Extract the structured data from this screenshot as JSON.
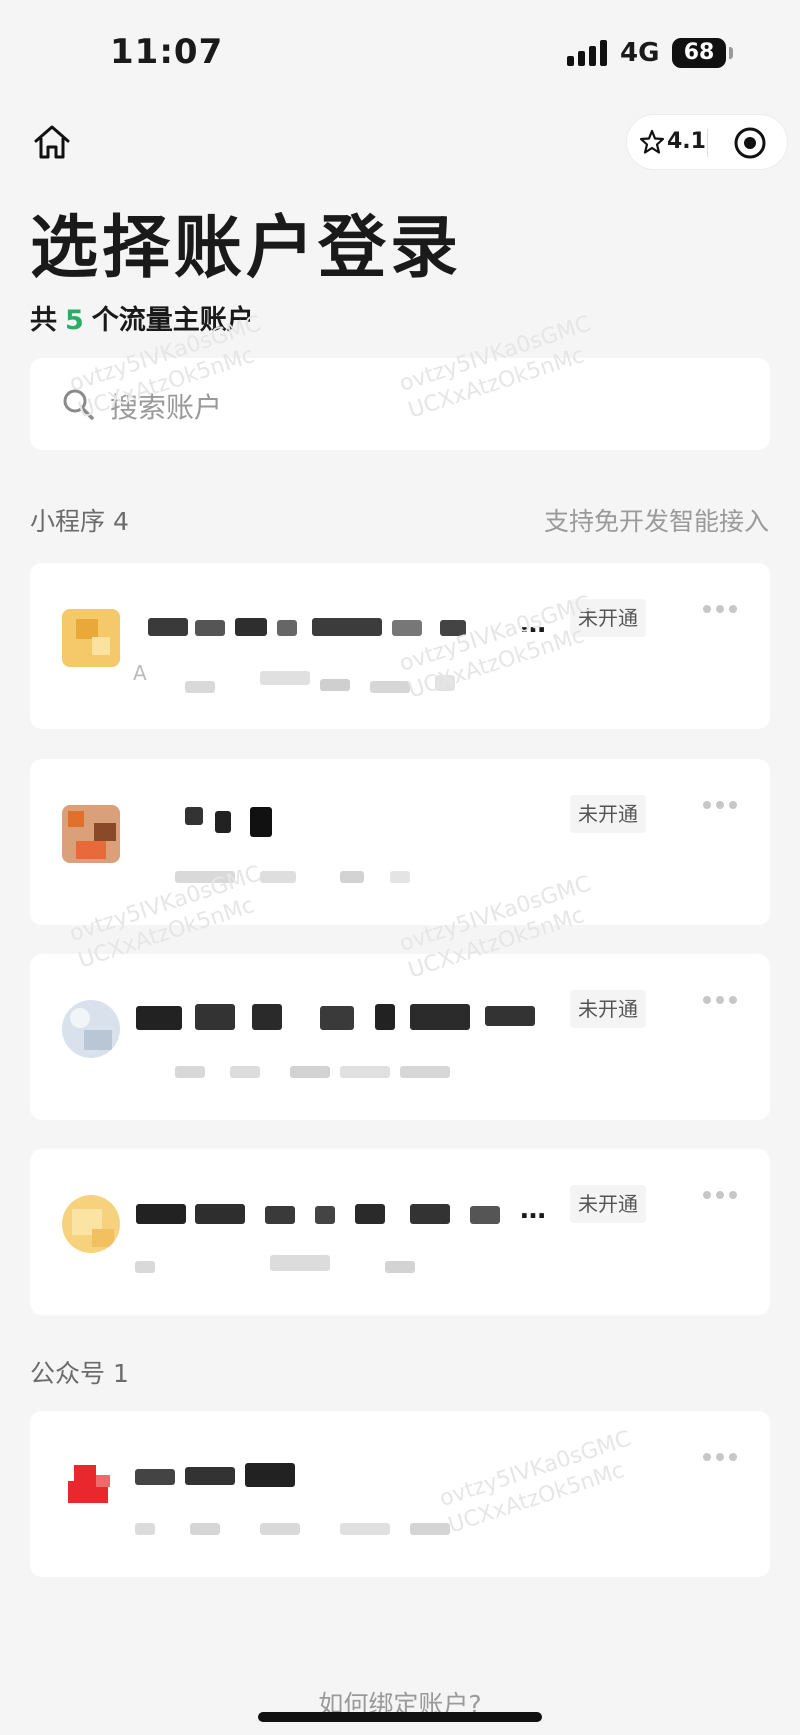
{
  "status_bar": {
    "time": "11:07",
    "network": "4G",
    "battery": "68"
  },
  "nav": {
    "capsule_rating": "4.1"
  },
  "header": {
    "title": "选择账户登录",
    "subtitle_prefix": "共",
    "account_count": "5",
    "subtitle_suffix": "个流量主账户"
  },
  "search": {
    "placeholder": "搜索账户"
  },
  "sections": {
    "miniprogram": {
      "label": "小程序 4",
      "link": "支持免开发智能接入"
    },
    "official": {
      "label": "公众号 1"
    }
  },
  "cards": [
    {
      "name": "…",
      "sub": "A",
      "status": "未开通",
      "avatar_color": "#f5c86a"
    },
    {
      "name": "",
      "sub": "",
      "status": "未开通",
      "avatar_color": "#d9a07a"
    },
    {
      "name": "",
      "sub": "",
      "status": "未开通",
      "avatar_color": "#d9e2ec"
    },
    {
      "name": "…",
      "sub": "",
      "status": "未开通",
      "avatar_color": "#f7d27e"
    },
    {
      "name": "",
      "sub": "",
      "status": "",
      "avatar_color": "#e8282d"
    }
  ],
  "watermark": {
    "line1": "ovtzy5IVKa0sGMC",
    "line2": "UCXxAtzOk5nMc"
  },
  "footer": {
    "link": "如何绑定账户?"
  },
  "colors": {
    "accent_green": "#2aae67",
    "background": "#f5f5f5",
    "card": "#ffffff",
    "official_avatar_red": "#e8282d"
  }
}
